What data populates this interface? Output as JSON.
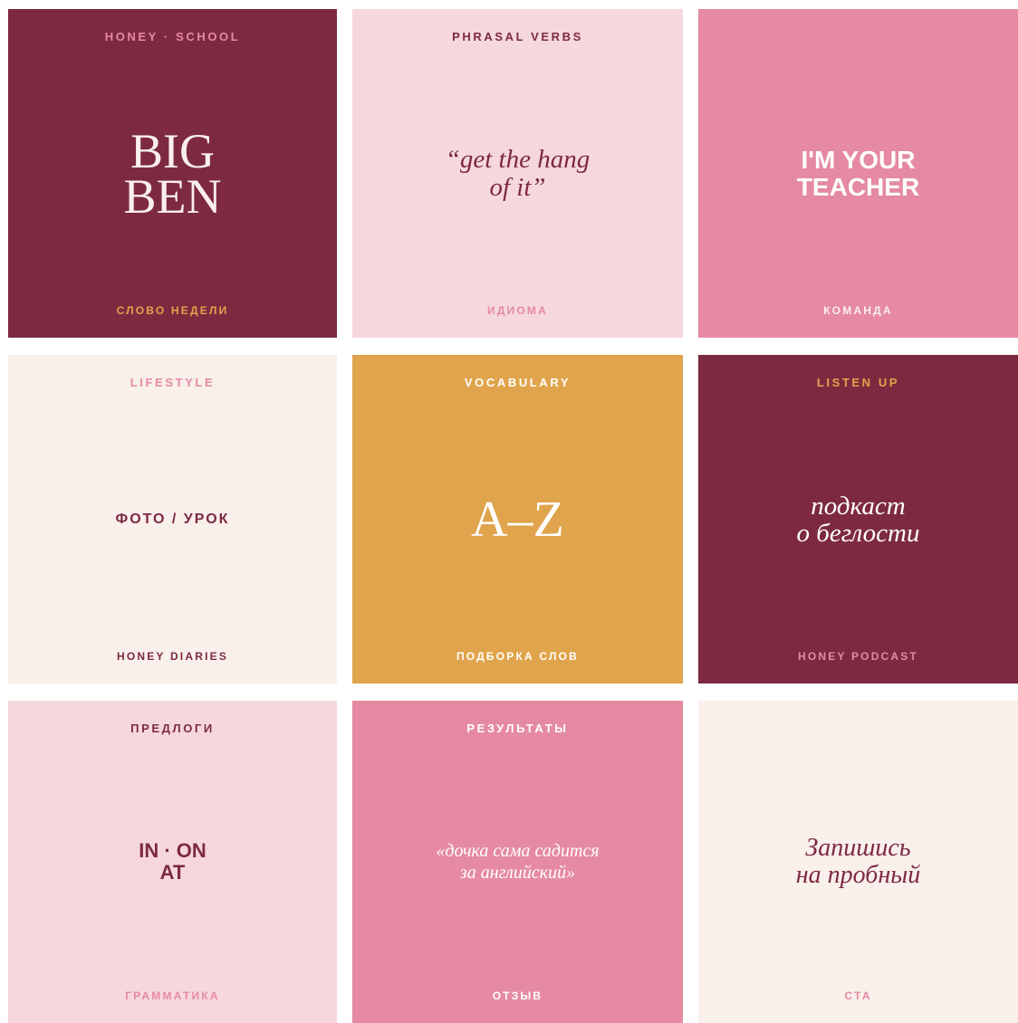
{
  "colors": {
    "wine": "#7d2a41",
    "blush": "#f6d8dc",
    "rose": "#e58aa2",
    "cream": "#f9efeb",
    "mustard": "#e0a44c",
    "gold": "#e0a44c"
  },
  "tiles": [
    {
      "top": "HONEY · SCHOOL",
      "main": "BIG\nBEN",
      "bottom": "СЛОВО НЕДЕЛИ"
    },
    {
      "top": "PHRASAL VERBS",
      "main": "“get the hang\nof it”",
      "bottom": "ИДИОМА"
    },
    {
      "top": "",
      "main": "I'M YOUR\nTEACHER",
      "bottom": "КОМАНДА"
    },
    {
      "top": "LIFESTYLE",
      "main": "ФОТО / УРОК",
      "bottom": "HONEY DIARIES"
    },
    {
      "top": "VOCABULARY",
      "main": "A–Z",
      "bottom": "ПОДБОРКА СЛОВ"
    },
    {
      "top": "LISTEN UP",
      "main": "подкаст\nо беглости",
      "bottom": "HONEY PODCAST"
    },
    {
      "top": "ПРЕДЛОГИ",
      "main": "IN · ON\nAT",
      "bottom": "ГРАММАТИКА"
    },
    {
      "top": "РЕЗУЛЬТАТЫ",
      "main": "«дочка сама садится\nза английский»",
      "bottom": "ОТЗЫВ"
    },
    {
      "top": "",
      "main": "Запишись\nна пробный",
      "bottom": "CTA"
    }
  ]
}
